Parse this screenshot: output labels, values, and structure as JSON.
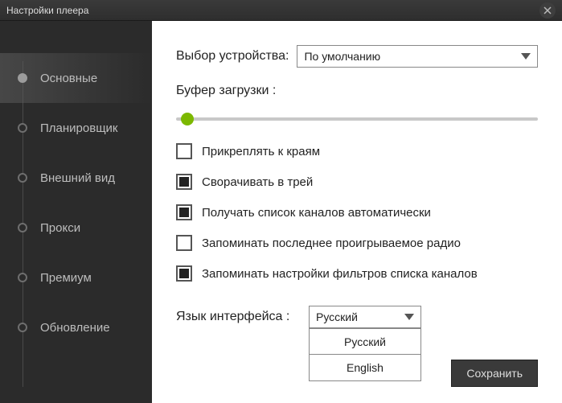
{
  "window": {
    "title": "Настройки плеера"
  },
  "sidebar": {
    "items": [
      {
        "label": "Основные",
        "active": true
      },
      {
        "label": "Планировщик",
        "active": false
      },
      {
        "label": "Внешний вид",
        "active": false
      },
      {
        "label": "Прокси",
        "active": false
      },
      {
        "label": "Премиум",
        "active": false
      },
      {
        "label": "Обновление",
        "active": false
      }
    ]
  },
  "device": {
    "label": "Выбор устройства:",
    "value": "По умолчанию"
  },
  "buffer": {
    "label": "Буфер загрузки :"
  },
  "checkboxes": [
    {
      "label": "Прикреплять к краям",
      "checked": false
    },
    {
      "label": "Сворачивать в трей",
      "checked": true
    },
    {
      "label": "Получать список каналов автоматически",
      "checked": true
    },
    {
      "label": "Запоминать последнее проигрываемое радио",
      "checked": false
    },
    {
      "label": "Запоминать настройки фильтров списка каналов",
      "checked": true
    }
  ],
  "language": {
    "label": "Язык интерфейса :",
    "value": "Русский",
    "options": [
      "Русский",
      "English"
    ]
  },
  "save_label": "Сохранить"
}
